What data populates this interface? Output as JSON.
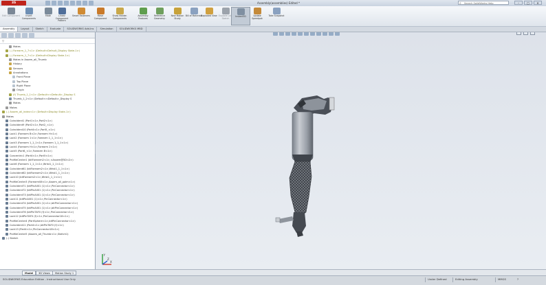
{
  "app": {
    "logo": "3S SOLIDWORKS",
    "window_title": "Assembly(assemblies) Edited *",
    "search_placeholder": "Search SolidWorks Help",
    "search_icon": "magnifier-icon",
    "win_controls": [
      "–",
      "□",
      "✕"
    ]
  },
  "ribbon": {
    "buttons": [
      {
        "label": "Edit Component",
        "icon": "edit-component-icon",
        "color": "#7a8796",
        "enabled": false
      },
      {
        "label": "Insert Components",
        "icon": "insert-components-icon",
        "color": "#6e8fb4",
        "enabled": true
      },
      {
        "label": "Mate",
        "icon": "mate-icon",
        "color": "#7a8a9a",
        "enabled": true
      },
      {
        "label": "Linear Component Pattern",
        "icon": "pattern-icon",
        "color": "#4f6e9a",
        "enabled": true
      },
      {
        "label": "Smart Fasteners",
        "icon": "fastener-icon",
        "color": "#d08b34",
        "enabled": true
      },
      {
        "label": "Move Component",
        "icon": "move-icon",
        "color": "#c97a2a",
        "enabled": true
      },
      {
        "label": "Show Hidden Components",
        "icon": "show-hidden-icon",
        "color": "#c9a84a",
        "enabled": true
      },
      {
        "label": "Assembly Features",
        "icon": "assembly-features-icon",
        "color": "#5f9e4e",
        "enabled": true
      },
      {
        "label": "Reference Geometry",
        "icon": "reference-geometry-icon",
        "color": "#6f9f5d",
        "enabled": true
      },
      {
        "label": "New Motion Study",
        "icon": "motion-study-icon",
        "color": "#c7a23a",
        "enabled": true
      },
      {
        "label": "Bill of Materials",
        "icon": "bom-icon",
        "color": "#8aa1c0",
        "enabled": true
      },
      {
        "label": "Exploded View",
        "icon": "exploded-view-icon",
        "color": "#d0a040",
        "enabled": true
      },
      {
        "label": "Explode Line Sketch",
        "icon": "explode-line-icon",
        "color": "#9ca3ac",
        "enabled": false
      },
      {
        "label": "Instant3D",
        "icon": "instant3d-icon",
        "color": "#7f8fa1",
        "enabled": true,
        "selected": true
      },
      {
        "label": "Update Speedpak",
        "icon": "speedpak-icon",
        "color": "#c48a3a",
        "enabled": true
      },
      {
        "label": "Take Snapshot",
        "icon": "snapshot-icon",
        "color": "#8aa1c0",
        "enabled": true
      }
    ]
  },
  "tabs": [
    "Assembly",
    "Layout",
    "Sketch",
    "Evaluate",
    "SOLIDWORKS Add-Ins",
    "Simulation",
    "SOLIDWORKS MBD"
  ],
  "featuretree": {
    "filter": "▽",
    "items": [
      {
        "text": "Mates",
        "indent": 2,
        "color": "#9a9a9a"
      },
      {
        "text": "(-) Forearm_1_7<1> (Default<Default_Display State-1>)",
        "indent": 1,
        "color": "#a6a647",
        "warn": true
      },
      {
        "text": "(-) Forearm_1_7<1> (Default<Display State-1>)",
        "indent": 1,
        "color": "#a6a647",
        "warn": true
      },
      {
        "text": "Mates in Assem_all_Thumb",
        "indent": 2,
        "color": "#9a9a9a"
      },
      {
        "text": "History",
        "indent": 2,
        "color": "#c8a74a"
      },
      {
        "text": "Sensors",
        "indent": 2,
        "color": "#c8a74a"
      },
      {
        "text": "Annotations",
        "indent": 2,
        "color": "#c8a74a"
      },
      {
        "text": "Front Plane",
        "indent": 3,
        "color": "#b8c4d0"
      },
      {
        "text": "Top Plane",
        "indent": 3,
        "color": "#b8c4d0"
      },
      {
        "text": "Right Plane",
        "indent": 3,
        "color": "#b8c4d0"
      },
      {
        "text": "Origin",
        "indent": 3,
        "color": "#9a9a9a"
      },
      {
        "text": "(f) Thumb_1_1<1> (Default<<Default>_Display S",
        "indent": 2,
        "color": "#a6a647",
        "warn": true
      },
      {
        "text": "Thumb_1_2<1> (Default<<Default>_Display S",
        "indent": 2,
        "color": "#7b8ea3"
      },
      {
        "text": "Mates",
        "indent": 2,
        "color": "#9a9a9a"
      },
      {
        "text": "Mates",
        "indent": 1,
        "color": "#9a9a9a"
      },
      {
        "text": "(-) Assem_all_index<1> (Default<Display State-1>)",
        "indent": 0,
        "color": "#a6a647",
        "warn": true
      },
      {
        "text": "Mates",
        "indent": 0,
        "color": "#9a9a9a"
      },
      {
        "text": "Coincident1 (Part1<1>,Part2<1>)",
        "indent": 1,
        "color": "#6a7d93"
      },
      {
        "text": "Coincident9 (Part2<1>,Part2_<1>)",
        "indent": 1,
        "color": "#6a7d93"
      },
      {
        "text": "Coincident10 (Part4<1>,Part5_<1>)",
        "indent": 1,
        "color": "#6a7d93"
      },
      {
        "text": "Lock1 (Forearm B<2>,Forearm H<1>)",
        "indent": 1,
        "color": "#6a7d93"
      },
      {
        "text": "Lock2 (Forearm 1<1>,Forearm 1_1_1<1>)",
        "indent": 1,
        "color": "#6a7d93"
      },
      {
        "text": "Lock3 (Forearm 1_1_1<1>,Forearm 1_1_1<1>)",
        "indent": 1,
        "color": "#6a7d93"
      },
      {
        "text": "Lock4 (Forearm H<1>,Forearm 2<1>)",
        "indent": 1,
        "color": "#6a7d93"
      },
      {
        "text": "Lock5 (Part6_<1>,Forearm B<1>)",
        "indent": 1,
        "color": "#6a7d93"
      },
      {
        "text": "Concentric1 (Part4<1>,Part5<1>)",
        "indent": 1,
        "color": "#6a7d93"
      },
      {
        "text": "ProfileCenter1 (bitForearm2<1>,<Assem@5D<2>)",
        "indent": 1,
        "color": "#6a7d93"
      },
      {
        "text": "Lock6 (Forearm 1_1_1<1>,Wrist1_1_1<1>)",
        "indent": 1,
        "color": "#6a7d93"
      },
      {
        "text": "Coincident61 (bitForearm2<1>,Wrist1_1_1<1>)",
        "indent": 1,
        "color": "#6a7d93"
      },
      {
        "text": "Coincident62 (bitForearm2<1>,Wrist1_1_1<1>)",
        "indent": 1,
        "color": "#6a7d93"
      },
      {
        "text": "Lock10 (bitForearm2<1>,Wrist1_1_1<1>)",
        "indent": 1,
        "color": "#6a7d93"
      },
      {
        "text": "ProfileCenter3 (ForearmS6<1>,Assem_all_palm<1>)",
        "indent": 1,
        "color": "#6a7d93"
      },
      {
        "text": "Coincident71 (bitPinAll01 (1)<1>,PinConnector<1>)",
        "indent": 1,
        "color": "#6a7d93"
      },
      {
        "text": "Coincident72 (bitPinAll01 (1)<1>,PinConnector<1>)",
        "indent": 1,
        "color": "#6a7d93"
      },
      {
        "text": "Coincident73 (bitPinAll01 (1)<1>,PinConnector<1>)",
        "indent": 1,
        "color": "#6a7d93"
      },
      {
        "text": "Lock11 (bitPinAll01 (1)<1>,PinConnector<1>)",
        "indent": 1,
        "color": "#6a7d93"
      },
      {
        "text": "Coincident74 (bitPinAll01 (1)<1>,bitPinConnector<1>)",
        "indent": 1,
        "color": "#6a7d93"
      },
      {
        "text": "Coincident75 (bitPinAll01 (1)<1>,bitPinConnector<1>)",
        "indent": 1,
        "color": "#6a7d93"
      },
      {
        "text": "Coincident76 (bitPinTAF0 (f)<1>,PinConnector<1>)",
        "indent": 1,
        "color": "#6a7d93"
      },
      {
        "text": "Lock12 (bitPinTAF0 (f)<1>,PinConnector18<1>)",
        "indent": 1,
        "color": "#6a7d93"
      },
      {
        "text": "ProfileCenter4 (PartSphere<1>,bitPinConnector<1>)",
        "indent": 1,
        "color": "#6a7d93"
      },
      {
        "text": "Coincident11 (Part4<1>,bitPinTAF0 (f)<1>)",
        "indent": 1,
        "color": "#6a7d93"
      },
      {
        "text": "Lock13 (Part4<1>,PinConnector18<1>)",
        "indent": 1,
        "color": "#6a7d93"
      },
      {
        "text": "ProfileCenter5 (Assem_all_Thumb<1>,Sketch1)",
        "indent": 1,
        "color": "#6a7d93"
      },
      {
        "text": "(-) Sketch",
        "indent": 0,
        "color": "#6a7d93"
      }
    ]
  },
  "viewport": {
    "triad_labels": [
      "Y",
      "X",
      "Z"
    ],
    "axis_colors": {
      "x": "#d03b2c",
      "y": "#2e9d3a",
      "z": "#2f5fd0"
    },
    "background": "#e4e8ee"
  },
  "bottom_tabs": [
    "Model",
    "3D Views",
    "Motion Study 1"
  ],
  "status": {
    "left": "SOLIDWORKS Education Edition - Instructional Use Only",
    "mode": "Under Defined",
    "editing": "Editing Assembly",
    "units": "MMGS",
    "help": "?"
  }
}
